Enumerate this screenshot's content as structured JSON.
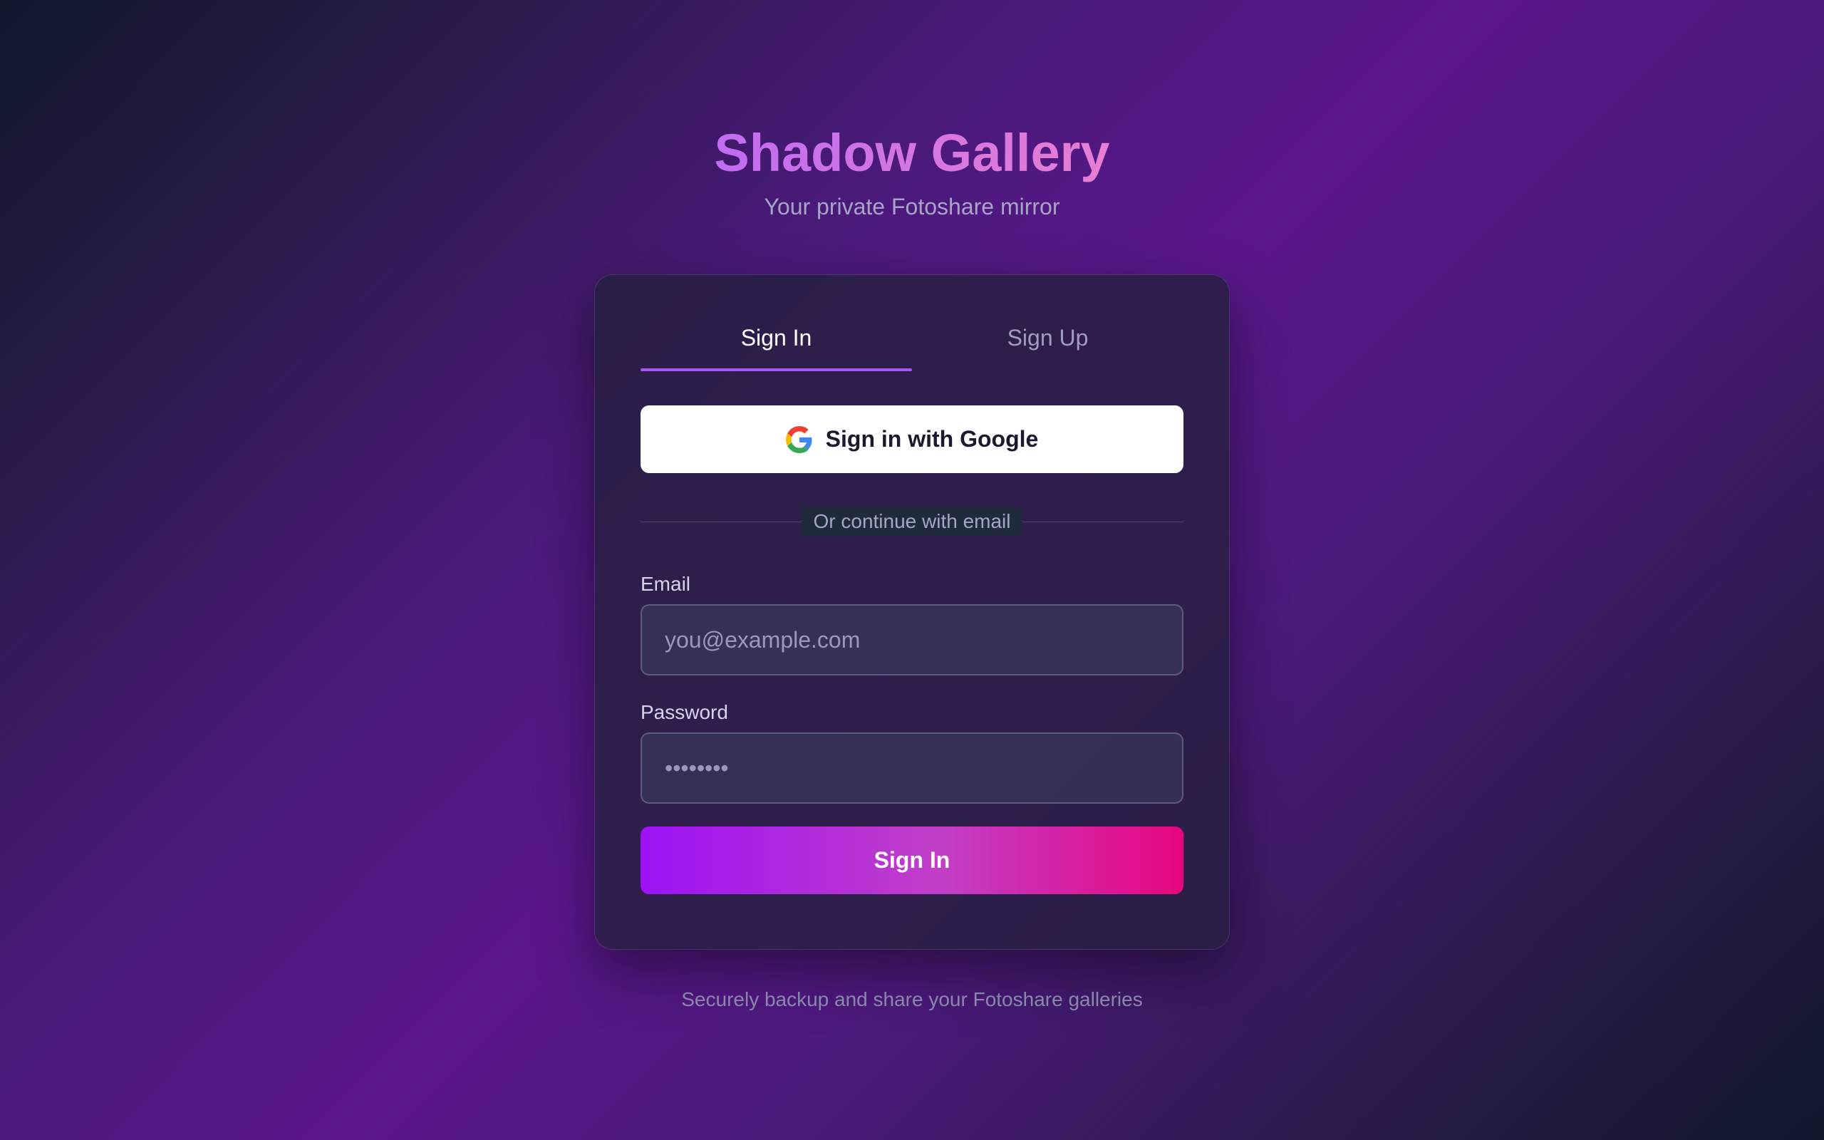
{
  "header": {
    "title": "Shadow Gallery",
    "subtitle": "Your private Fotoshare mirror"
  },
  "tabs": [
    {
      "label": "Sign In",
      "active": true
    },
    {
      "label": "Sign Up",
      "active": false
    }
  ],
  "google_button": {
    "label": "Sign in with Google",
    "icon": "google-g-icon"
  },
  "divider": {
    "text": "Or continue with email"
  },
  "form": {
    "email_label": "Email",
    "email_placeholder": "you@example.com",
    "email_value": "",
    "password_label": "Password",
    "password_placeholder": "••••••••",
    "password_value": "",
    "submit_label": "Sign In"
  },
  "footer": {
    "text": "Securely backup and share your Fotoshare galleries"
  },
  "colors": {
    "accent": "#a855f7",
    "title_gradient_start": "#c06cf2",
    "title_gradient_end": "#e77ed2",
    "submit_gradient_start": "#9d12f5",
    "submit_gradient_end": "#e8067f"
  }
}
